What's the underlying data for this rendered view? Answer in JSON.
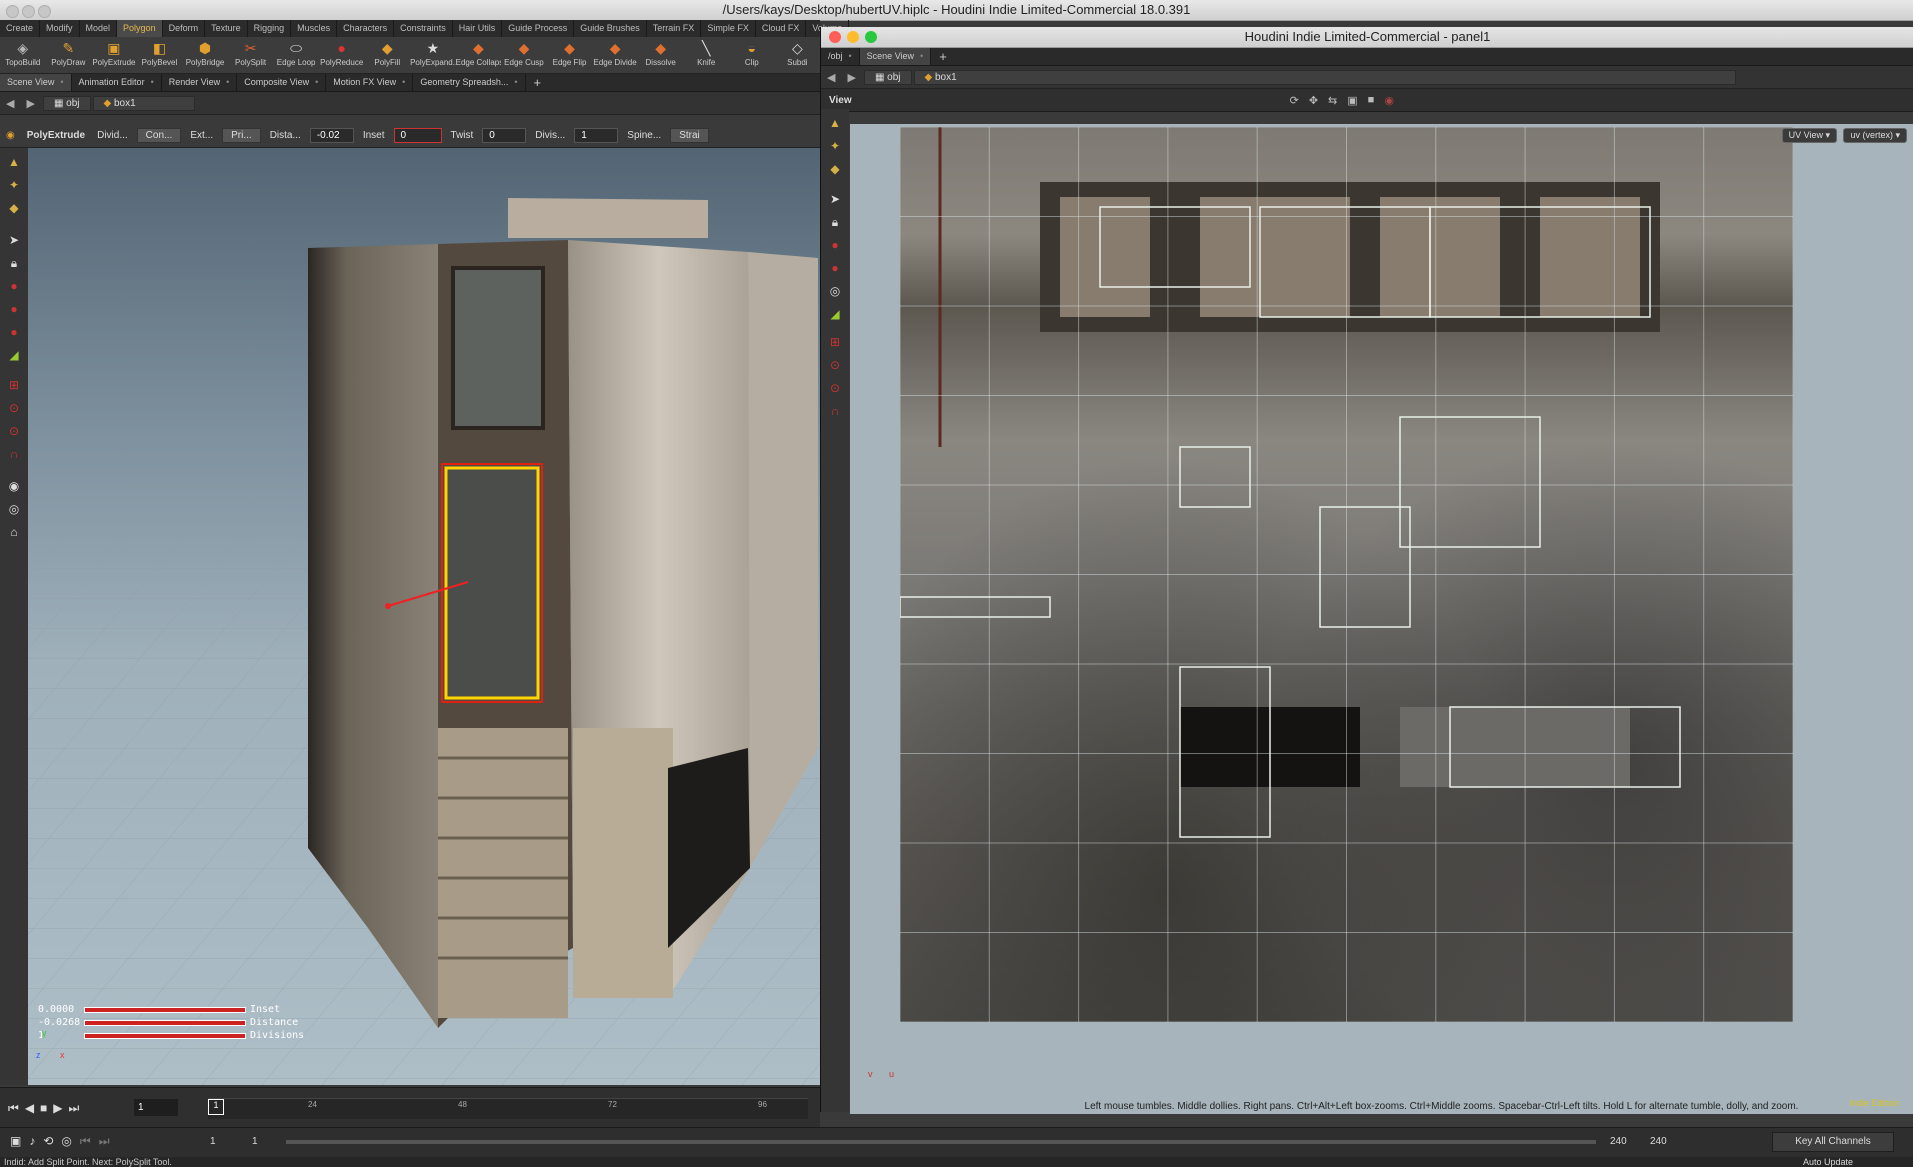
{
  "window": {
    "title": "/Users/kays/Desktop/hubertUV.hiplc - Houdini Indie Limited-Commercial 18.0.391"
  },
  "shelf_tabs": [
    "Create",
    "Modify",
    "Model",
    "Polygon",
    "Deform",
    "Texture",
    "Rigging",
    "Muscles",
    "Characters",
    "Constraints",
    "Hair Utils",
    "Guide Process",
    "Guide Brushes",
    "Terrain FX",
    "Simple FX",
    "Cloud FX",
    "Volume"
  ],
  "shelf_tools": [
    {
      "label": "TopoBuild",
      "icon": "topobuild-icon"
    },
    {
      "label": "PolyDraw",
      "icon": "polydraw-icon"
    },
    {
      "label": "PolyExtrude",
      "icon": "polyextrude-icon"
    },
    {
      "label": "PolyBevel",
      "icon": "polybevel-icon"
    },
    {
      "label": "PolyBridge",
      "icon": "polybridge-icon"
    },
    {
      "label": "PolySplit",
      "icon": "polysplit-icon"
    },
    {
      "label": "Edge Loop",
      "icon": "edge-loop-icon"
    },
    {
      "label": "PolyReduce",
      "icon": "polyreduce-icon"
    },
    {
      "label": "PolyFill",
      "icon": "polyfill-icon"
    },
    {
      "label": "PolyExpand...",
      "icon": "polyexpand-icon"
    },
    {
      "label": "Edge Collapse",
      "icon": "edge-collapse-icon"
    },
    {
      "label": "Edge Cusp",
      "icon": "edge-cusp-icon"
    },
    {
      "label": "Edge Flip",
      "icon": "edge-flip-icon"
    },
    {
      "label": "Edge Divide",
      "icon": "edge-divide-icon"
    },
    {
      "label": "Dissolve",
      "icon": "dissolve-icon"
    },
    {
      "label": "Knife",
      "icon": "knife-icon"
    },
    {
      "label": "Clip",
      "icon": "clip-icon"
    },
    {
      "label": "Subdi",
      "icon": "subdivide-icon"
    }
  ],
  "left_pane": {
    "tabs": [
      "Scene View",
      "Animation Editor",
      "Render View",
      "Composite View",
      "Motion FX View",
      "Geometry Spreadsh..."
    ],
    "path": {
      "network": "obj",
      "node": "box1"
    },
    "operation": {
      "name": "PolyExtrude",
      "divide_label": "Divid...",
      "divide_value": "Con...",
      "ext_label": "Ext...",
      "ext_value": "Pri...",
      "distance_label": "Dista...",
      "distance_value": "-0.02",
      "inset_label": "Inset",
      "inset_value": "0",
      "twist_label": "Twist",
      "twist_value": "0",
      "divisions_label": "Divis...",
      "divisions_value": "1",
      "spine_label": "Spine...",
      "strai_label": "Strai"
    },
    "handle_readout": [
      {
        "value": "0.0000",
        "label": "Inset"
      },
      {
        "value": "-0.0268",
        "label": "Distance"
      },
      {
        "value": "1",
        "label": "Divisions"
      }
    ],
    "axis_labels": {
      "y": "y",
      "z": "z",
      "x": "x"
    }
  },
  "right_window": {
    "title": "Houdini Indie Limited-Commercial - panel1",
    "tabs": [
      "/obj",
      "Scene View"
    ],
    "path": {
      "network": "obj",
      "node": "box1"
    },
    "view_title": "View",
    "uv_view_menu": "UV View",
    "uv_attr_menu": "uv (vertex)",
    "hint": "Left mouse tumbles. Middle dollies. Right pans. Ctrl+Alt+Left box-zooms. Ctrl+Middle zooms. Spacebar-Ctrl-Left tilts. Hold L for alternate tumble, dolly, and zoom.",
    "indie_badge": "Indie Edition",
    "axis": {
      "v": "v",
      "u": "u"
    }
  },
  "playbar": {
    "current_frame": "1",
    "ticks": [
      "24",
      "48",
      "72",
      "96"
    ],
    "start": "1",
    "range_start": "1",
    "end": "240",
    "range_end": "240",
    "key_all": "Key All Channels",
    "auto_update": "Auto Update"
  },
  "status": "Indid: Add Split Point. Next: PolySplit Tool."
}
